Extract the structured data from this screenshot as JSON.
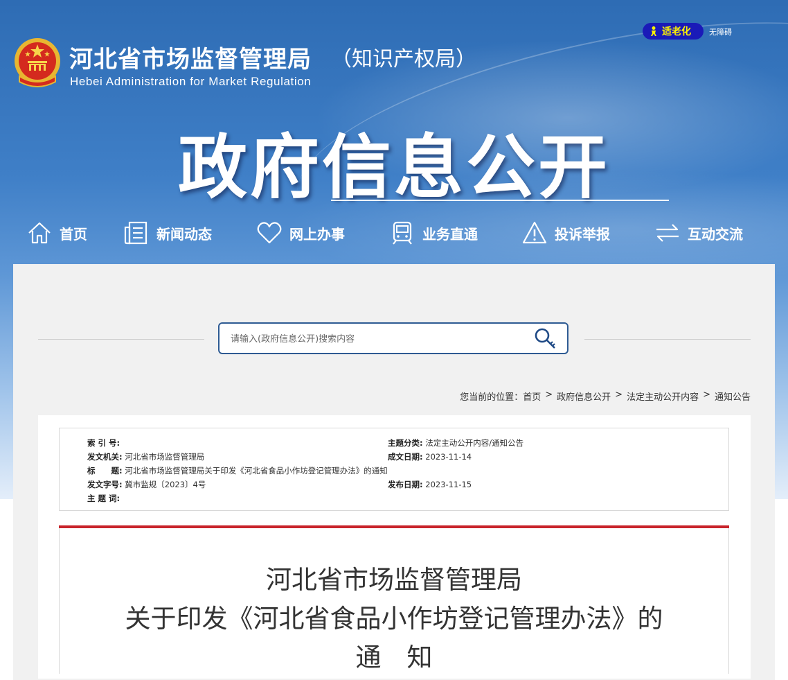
{
  "header": {
    "title": "河北省市场监督管理局",
    "title_suffix": "（知识产权局）",
    "title_en": "Hebei  Administration  for  Market  Regulation",
    "elder_mode_label": "适老化",
    "accessibility_label": "无障碍",
    "banner_title": "政府信息公开"
  },
  "nav": {
    "items": [
      {
        "label": "首页",
        "icon": "home-icon"
      },
      {
        "label": "新闻动态",
        "icon": "news-icon"
      },
      {
        "label": "网上办事",
        "icon": "heart-icon"
      },
      {
        "label": "业务直通",
        "icon": "train-icon"
      },
      {
        "label": "投诉举报",
        "icon": "warning-icon"
      },
      {
        "label": "互动交流",
        "icon": "exchange-icon"
      }
    ]
  },
  "search": {
    "placeholder": "请输入(政府信息公开)搜索内容"
  },
  "breadcrumb": {
    "prefix": "您当前的位置：",
    "items": [
      "首页",
      "政府信息公开",
      "法定主动公开内容",
      "通知公告"
    ],
    "separator": ">"
  },
  "meta": {
    "index_label": "索 引 号:",
    "index_value": "",
    "category_label": "主题分类:",
    "category_value": "法定主动公开内容/通知公告",
    "issuer_label": "发文机关:",
    "issuer_value": "河北省市场监督管理局",
    "created_label": "成文日期:",
    "created_value": "2023-11-14",
    "title_label": "标　　题:",
    "title_value": "河北省市场监督管理局关于印发《河北省食品小作坊登记管理办法》的通知",
    "docno_label": "发文字号:",
    "docno_value": "冀市监规〔2023〕4号",
    "published_label": "发布日期:",
    "published_value": "2023-11-15",
    "keywords_label": "主 题 词:",
    "keywords_value": ""
  },
  "document": {
    "title_line1": "河北省市场监督管理局",
    "title_line2": "关于印发《河北省食品小作坊登记管理办法》的",
    "title_line3": "通　知"
  },
  "colors": {
    "header_blue": "#2e6cb4",
    "elder_button": "#1a1ab8",
    "elder_text": "#fff200",
    "search_border": "#2e5b93",
    "red_bar": "#c8242b"
  }
}
